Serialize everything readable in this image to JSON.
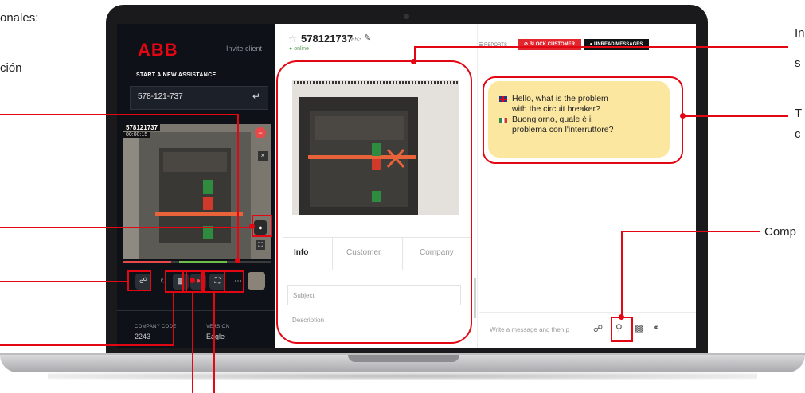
{
  "side_left": [
    "onales:",
    "ción"
  ],
  "side_right": [
    "In",
    "s",
    "T",
    "c",
    "Comp"
  ],
  "left_panel": {
    "logo": "ABB",
    "invite": "Invite client",
    "start_title": "START A NEW ASSISTANCE",
    "phone_value": "578-121-737",
    "enter_icon": "enter-icon",
    "video_id": "578121737",
    "video_time": "00:00:15",
    "company_code_label": "COMPANY CODE",
    "company_code": "2243",
    "version_label": "VERSION",
    "version": "Eagle"
  },
  "customer": {
    "id": "578121737",
    "count": "853",
    "status": "online"
  },
  "tabs": [
    "Info",
    "Customer",
    "Company"
  ],
  "fields": {
    "subject_placeholder": "Subject",
    "description_placeholder": "Description"
  },
  "header_buttons": {
    "reports": "REPORTS",
    "block": "BLOCK CUSTOMER",
    "unread": "UNREAD MESSAGES"
  },
  "chat": {
    "message_en_1": "Hello, what is the problem",
    "message_en_2": "with the circuit breaker?",
    "message_it_1": "Buongiorno, quale è il",
    "message_it_2": "problema con l'interruttore?"
  },
  "composer": {
    "placeholder": "Write a message and then p"
  },
  "colors": {
    "accent": "#e30613",
    "bubble": "#fbe7a0",
    "dark_panel": "#0e1117"
  }
}
